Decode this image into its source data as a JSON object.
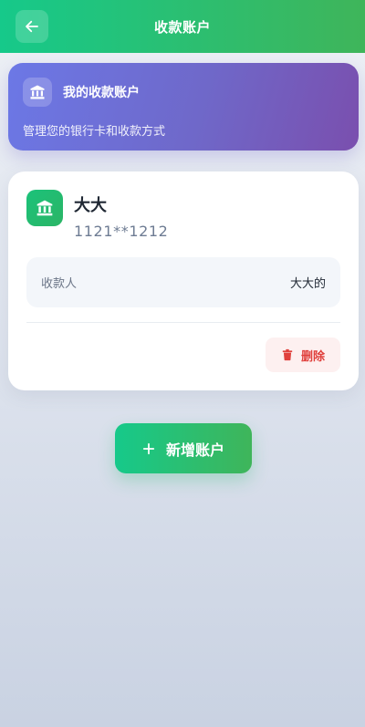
{
  "header": {
    "title": "收款账户",
    "back_icon": "arrow-left-icon"
  },
  "banner": {
    "icon": "bank-icon",
    "title": "我的收款账户",
    "subtitle": "管理您的银行卡和收款方式"
  },
  "accounts": [
    {
      "icon": "bank-icon",
      "name": "大大",
      "number": "1121**1212",
      "payee_label": "收款人",
      "payee_value": "大大的",
      "delete_label": "删除",
      "delete_icon": "trash-icon"
    }
  ],
  "actions": {
    "add_label": "新增账户",
    "add_icon": "plus-icon"
  },
  "colors": {
    "primary_start": "#16c98a",
    "primary_end": "#3fb55a",
    "banner_start": "#6c78e6",
    "banner_end": "#7a4fae",
    "danger": "#e0403c"
  }
}
